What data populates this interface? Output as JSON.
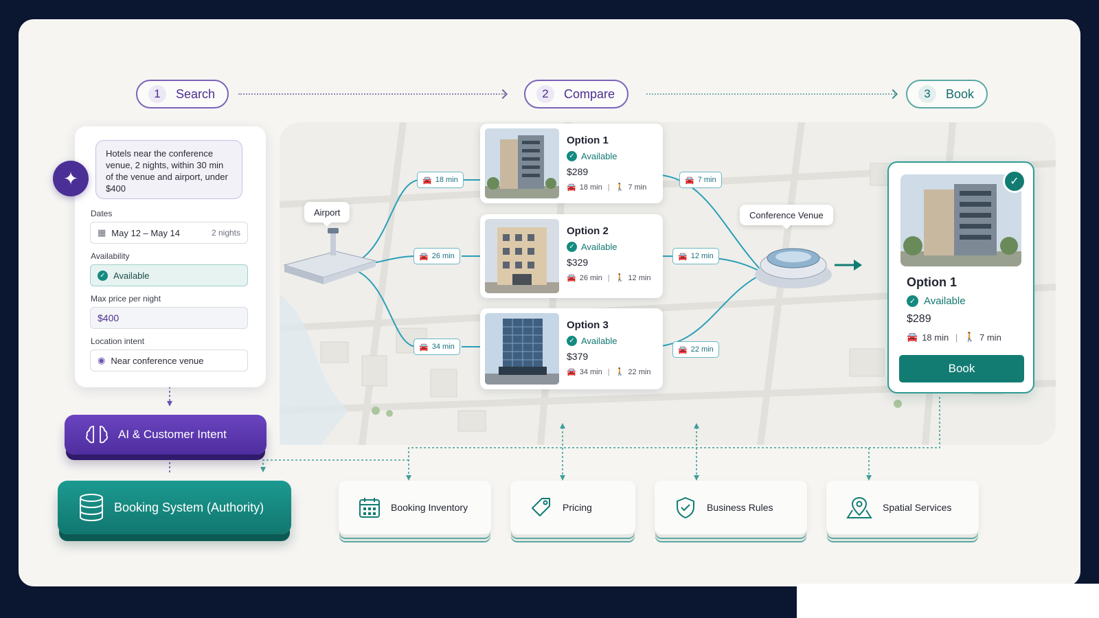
{
  "steps": [
    {
      "num": "1",
      "label": "Search"
    },
    {
      "num": "2",
      "label": "Compare"
    },
    {
      "num": "3",
      "label": "Book"
    }
  ],
  "search_panel": {
    "prompt": "Hotels near the conference venue, 2 nights, within 30 min of the venue and airport, under $400",
    "dates_label": "Dates",
    "dates_value": "May 12 – May 14",
    "dates_nights": "2 nights",
    "availability_label": "Availability",
    "availability_value": "Available",
    "price_label": "Max price per night",
    "price_value": "$400",
    "location_label": "Location intent",
    "location_value": "Near conference venue"
  },
  "map": {
    "airport_label": "Airport",
    "venue_label": "Conference Venue"
  },
  "options": [
    {
      "title": "Option 1",
      "status": "Available",
      "price": "$289",
      "drive": "18 min",
      "walk": "7 min",
      "to_airport": "18 min",
      "to_venue": "7 min"
    },
    {
      "title": "Option 2",
      "status": "Available",
      "price": "$329",
      "drive": "26 min",
      "walk": "12 min",
      "to_airport": "26 min",
      "to_venue": "12 min"
    },
    {
      "title": "Option 3",
      "status": "Available",
      "price": "$379",
      "drive": "34 min",
      "walk": "22 min",
      "to_airport": "34 min",
      "to_venue": "22 min"
    }
  ],
  "selected": {
    "title": "Option 1",
    "status": "Available",
    "price": "$289",
    "drive": "18 min",
    "walk": "7 min",
    "book_label": "Book"
  },
  "systems": {
    "ai": "AI & Customer Intent",
    "booking": "Booking System (Authority)"
  },
  "services": [
    {
      "label": "Booking Inventory",
      "icon": "calendar-icon"
    },
    {
      "label": "Pricing",
      "icon": "price-tag-icon"
    },
    {
      "label": "Business Rules",
      "icon": "shield-check-icon"
    },
    {
      "label": "Spatial Services",
      "icon": "map-pin-icon"
    }
  ],
  "colors": {
    "purple": "#4b2f8f",
    "teal": "#127c73",
    "background": "#0b1630",
    "canvas": "#f6f5f2"
  }
}
